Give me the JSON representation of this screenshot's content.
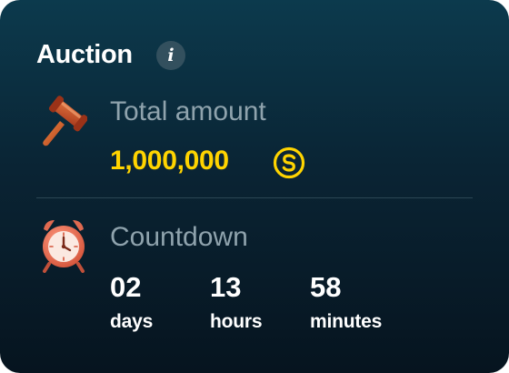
{
  "auction": {
    "title": "Auction",
    "info_glyph": "i",
    "info_icon": "info-icon",
    "total_amount": {
      "label": "Total amount",
      "value": "1,000,000",
      "icon": "gavel-icon",
      "currency_icon": "coin-icon",
      "value_color": "#ffd400"
    },
    "countdown": {
      "label": "Countdown",
      "icon": "alarm-clock-icon",
      "units": [
        {
          "value": "02",
          "unit": "days"
        },
        {
          "value": "13",
          "unit": "hours"
        },
        {
          "value": "58",
          "unit": "minutes"
        }
      ]
    }
  }
}
